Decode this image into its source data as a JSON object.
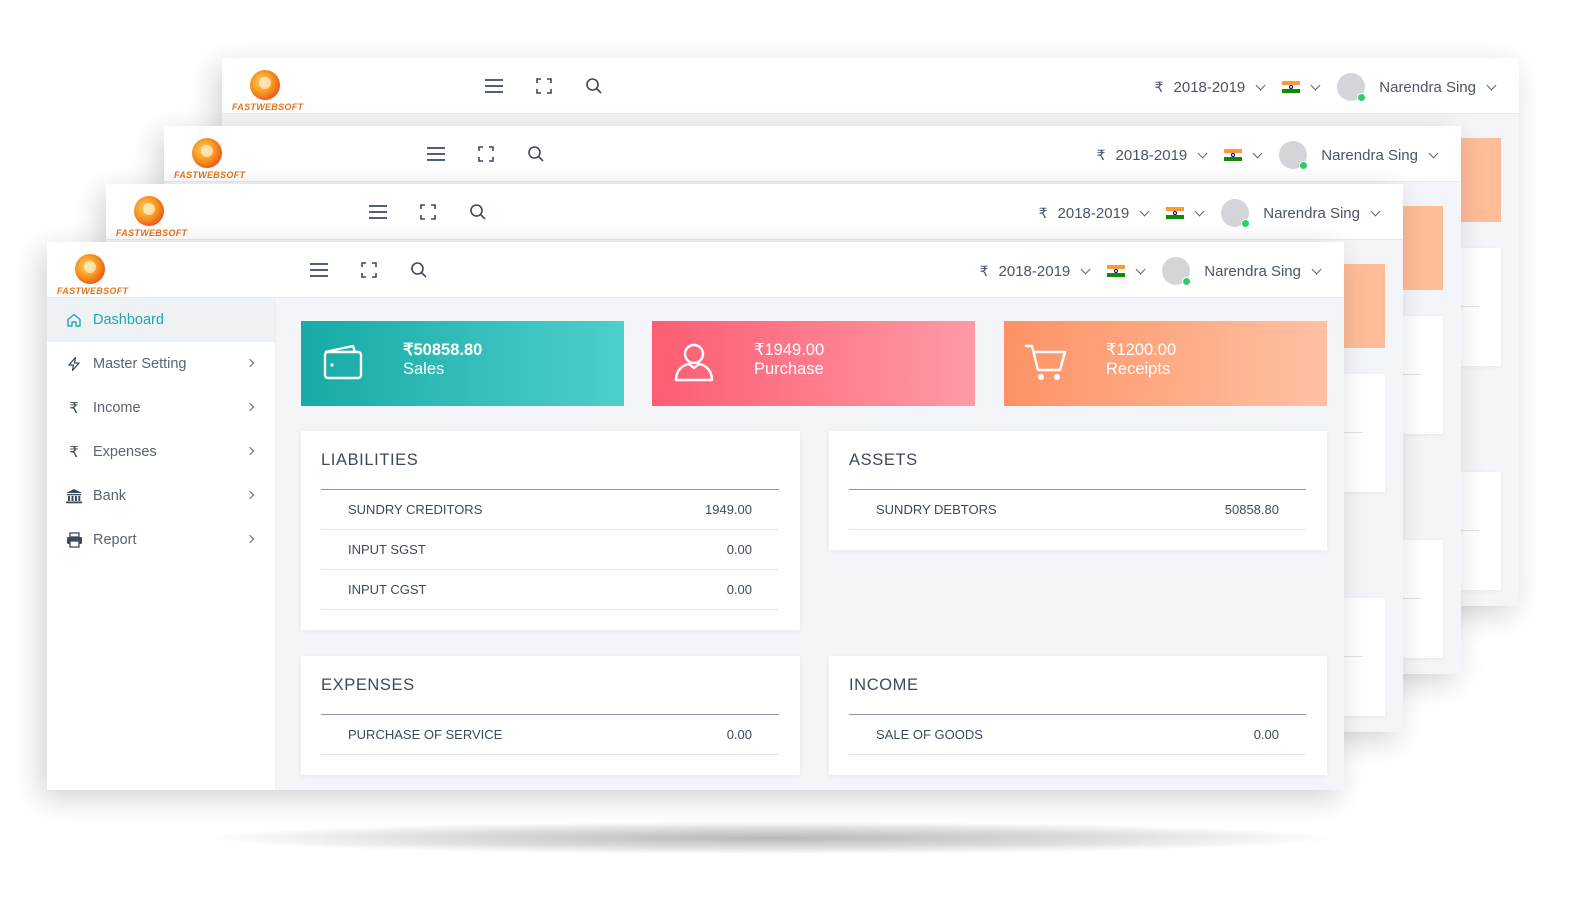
{
  "brand": {
    "name": "FASTWEBSOFT",
    "colors": {
      "teal": "#1fa9a6",
      "pink": "#fd5d73",
      "orange": "#fe9264"
    }
  },
  "topbar": {
    "currency_symbol": "₹",
    "fiscal_year": "2018-2019",
    "flag": "india-flag-icon",
    "user_name": "Narendra Sing",
    "icons": [
      "menu-icon",
      "fullscreen-icon",
      "search-icon"
    ]
  },
  "sidebar": {
    "items": [
      {
        "label": "Dashboard",
        "icon": "home-icon",
        "active": true
      },
      {
        "label": "Master Setting",
        "icon": "bolt-icon"
      },
      {
        "label": "Income",
        "icon": "rupee-icon"
      },
      {
        "label": "Expenses",
        "icon": "rupee-icon"
      },
      {
        "label": "Bank",
        "icon": "bank-icon"
      },
      {
        "label": "Report",
        "icon": "printer-icon"
      }
    ]
  },
  "stats": {
    "sales": {
      "amount": "₹50858.80",
      "label": "Sales",
      "icon": "wallet-icon"
    },
    "purchase": {
      "amount": "₹1949.00",
      "label": "Purchase",
      "icon": "user-icon"
    },
    "receipts": {
      "amount": "₹1200.00",
      "label": "Receipts",
      "icon": "cart-icon"
    }
  },
  "panels": {
    "liabilities": {
      "title": "LIABILITIES",
      "rows": [
        {
          "name": "SUNDRY CREDITORS",
          "value": "1949.00"
        },
        {
          "name": "INPUT SGST",
          "value": "0.00"
        },
        {
          "name": "INPUT CGST",
          "value": "0.00"
        }
      ]
    },
    "assets": {
      "title": "ASSETS",
      "rows": [
        {
          "name": "SUNDRY DEBTORS",
          "value": "50858.80"
        }
      ]
    },
    "expenses": {
      "title": "EXPENSES",
      "rows": [
        {
          "name": "PURCHASE OF SERVICE",
          "value": "0.00"
        }
      ]
    },
    "income": {
      "title": "INCOME",
      "rows": [
        {
          "name": "SALE OF GOODS",
          "value": "0.00"
        }
      ]
    }
  }
}
